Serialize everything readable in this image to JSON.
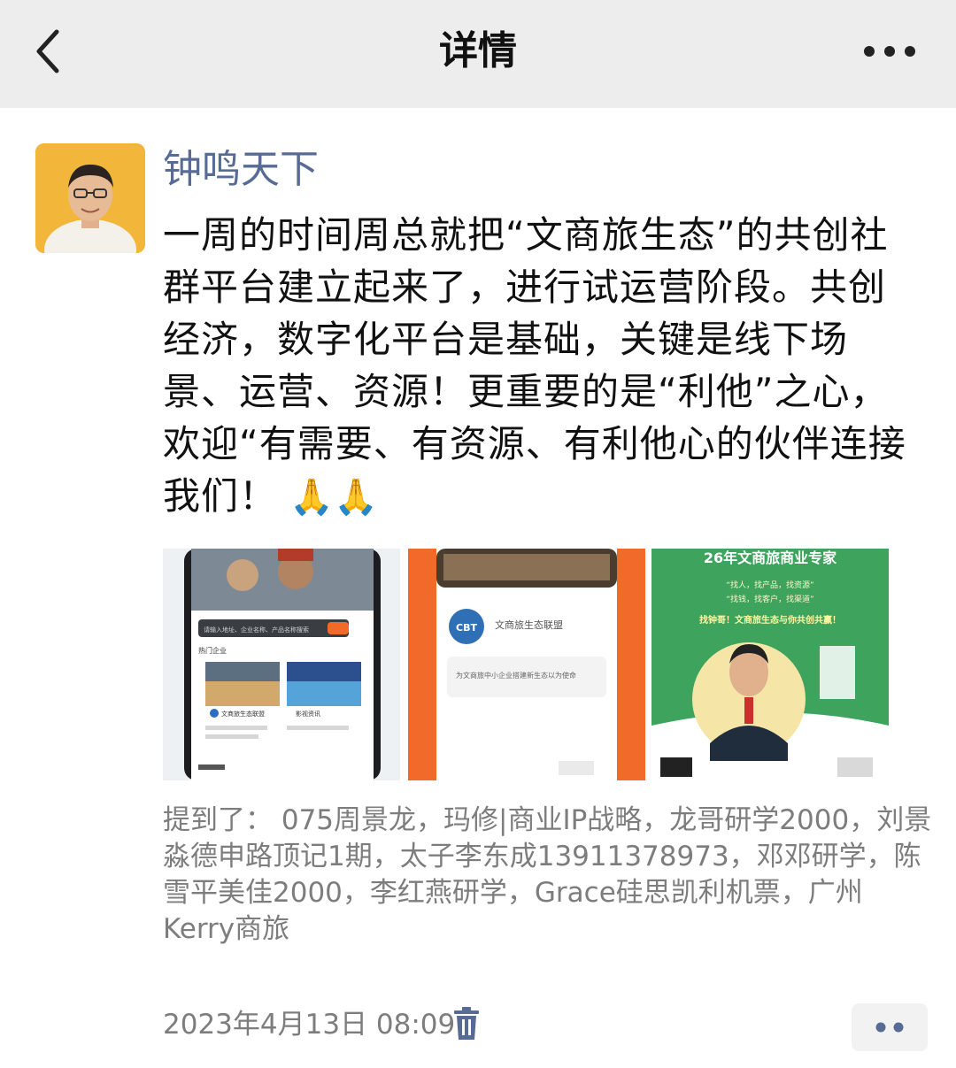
{
  "header": {
    "title": "详情",
    "back_icon": "chevron-left-icon",
    "more_icon": "more-dots-icon"
  },
  "post": {
    "author": "钟鸣天下",
    "text": "一周的时间周总就把“文商旅生态”的共创社群平台建立起来了，进行试运营阶段。共创经济，数字化平台是基础，关键是线下场景、运营、资源！更重要的是“利他”之心，欢迎“有需要、有资源、有利他心的伙伴连接我们！",
    "emoji": "🙏🙏",
    "images": [
      {
        "name": "app-screenshot-phone",
        "texts": [
          "请输入地址、企业名称、产品名称搜索",
          "热门企业",
          "文商旅生态联盟",
          "影视资讯"
        ]
      },
      {
        "name": "cbt-alliance-card",
        "texts": [
          "CBT",
          "文商旅生态联盟",
          "为文商旅中小企业搭建新生态以为使命"
        ]
      },
      {
        "name": "expert-poster",
        "texts": [
          "26年文商旅商业专家",
          "“找人，找产品，找资源”",
          "“找钱，找客户，找渠道”",
          "找钟哥！文商旅生态与你共创共赢！"
        ]
      }
    ],
    "mentions": "提到了： 075周景龙，玛修|商业IP战略，龙哥研学2000，刘景淼德申路顶记1期，太子李东成13911378973，邓邓研学，陈雪平美佳2000，李红燕研学，Grace硅思凯利机票，广州Kerry商旅",
    "timestamp": "2023年4月13日 08:09",
    "delete_icon": "trash-icon",
    "action_icon": "two-dots-icon"
  },
  "colors": {
    "header_bg": "#ededed",
    "author_blue": "#576b95",
    "meta_gray": "#7d7d7d",
    "orange": "#f26a2a",
    "green": "#3da35d"
  }
}
